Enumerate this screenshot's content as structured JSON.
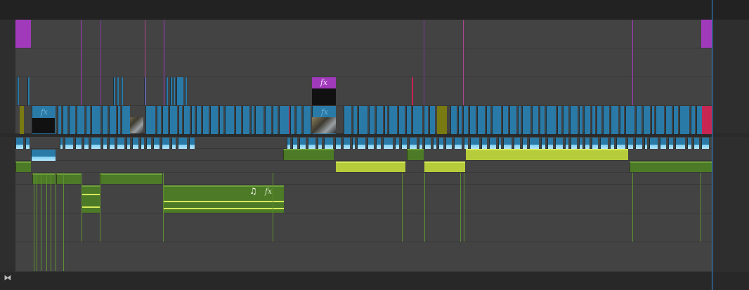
{
  "app": {
    "panel": "timeline"
  },
  "colors": {
    "video_clip": "#2a7aa8",
    "video_clip_waveform": "#7fd1f5",
    "audio_clip": "#4c7a26",
    "audio_clip_selected": "#b6cc3a",
    "adjustment_layer": "#a13aba",
    "color_matte": "#c72552",
    "playhead": "#3a8ee6"
  },
  "labels": {
    "fx": "fx",
    "music_note": "♫",
    "toggle_icon": "⧓"
  },
  "icons": [
    "fx-badge-icon",
    "music-note-icon",
    "toggle-tracks-icon"
  ]
}
